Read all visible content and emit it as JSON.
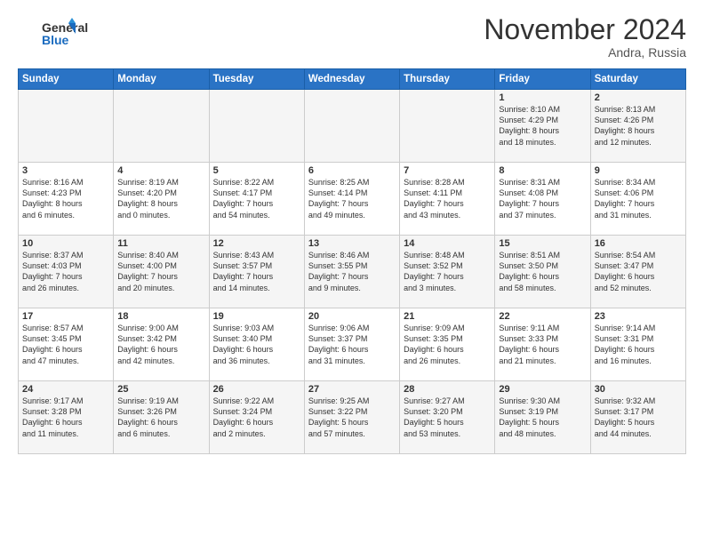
{
  "header": {
    "logo_line1": "General",
    "logo_line2": "Blue",
    "month_title": "November 2024",
    "location": "Andra, Russia"
  },
  "weekdays": [
    "Sunday",
    "Monday",
    "Tuesday",
    "Wednesday",
    "Thursday",
    "Friday",
    "Saturday"
  ],
  "weeks": [
    [
      {
        "day": "",
        "content": ""
      },
      {
        "day": "",
        "content": ""
      },
      {
        "day": "",
        "content": ""
      },
      {
        "day": "",
        "content": ""
      },
      {
        "day": "",
        "content": ""
      },
      {
        "day": "1",
        "content": "Sunrise: 8:10 AM\nSunset: 4:29 PM\nDaylight: 8 hours\nand 18 minutes."
      },
      {
        "day": "2",
        "content": "Sunrise: 8:13 AM\nSunset: 4:26 PM\nDaylight: 8 hours\nand 12 minutes."
      }
    ],
    [
      {
        "day": "3",
        "content": "Sunrise: 8:16 AM\nSunset: 4:23 PM\nDaylight: 8 hours\nand 6 minutes."
      },
      {
        "day": "4",
        "content": "Sunrise: 8:19 AM\nSunset: 4:20 PM\nDaylight: 8 hours\nand 0 minutes."
      },
      {
        "day": "5",
        "content": "Sunrise: 8:22 AM\nSunset: 4:17 PM\nDaylight: 7 hours\nand 54 minutes."
      },
      {
        "day": "6",
        "content": "Sunrise: 8:25 AM\nSunset: 4:14 PM\nDaylight: 7 hours\nand 49 minutes."
      },
      {
        "day": "7",
        "content": "Sunrise: 8:28 AM\nSunset: 4:11 PM\nDaylight: 7 hours\nand 43 minutes."
      },
      {
        "day": "8",
        "content": "Sunrise: 8:31 AM\nSunset: 4:08 PM\nDaylight: 7 hours\nand 37 minutes."
      },
      {
        "day": "9",
        "content": "Sunrise: 8:34 AM\nSunset: 4:06 PM\nDaylight: 7 hours\nand 31 minutes."
      }
    ],
    [
      {
        "day": "10",
        "content": "Sunrise: 8:37 AM\nSunset: 4:03 PM\nDaylight: 7 hours\nand 26 minutes."
      },
      {
        "day": "11",
        "content": "Sunrise: 8:40 AM\nSunset: 4:00 PM\nDaylight: 7 hours\nand 20 minutes."
      },
      {
        "day": "12",
        "content": "Sunrise: 8:43 AM\nSunset: 3:57 PM\nDaylight: 7 hours\nand 14 minutes."
      },
      {
        "day": "13",
        "content": "Sunrise: 8:46 AM\nSunset: 3:55 PM\nDaylight: 7 hours\nand 9 minutes."
      },
      {
        "day": "14",
        "content": "Sunrise: 8:48 AM\nSunset: 3:52 PM\nDaylight: 7 hours\nand 3 minutes."
      },
      {
        "day": "15",
        "content": "Sunrise: 8:51 AM\nSunset: 3:50 PM\nDaylight: 6 hours\nand 58 minutes."
      },
      {
        "day": "16",
        "content": "Sunrise: 8:54 AM\nSunset: 3:47 PM\nDaylight: 6 hours\nand 52 minutes."
      }
    ],
    [
      {
        "day": "17",
        "content": "Sunrise: 8:57 AM\nSunset: 3:45 PM\nDaylight: 6 hours\nand 47 minutes."
      },
      {
        "day": "18",
        "content": "Sunrise: 9:00 AM\nSunset: 3:42 PM\nDaylight: 6 hours\nand 42 minutes."
      },
      {
        "day": "19",
        "content": "Sunrise: 9:03 AM\nSunset: 3:40 PM\nDaylight: 6 hours\nand 36 minutes."
      },
      {
        "day": "20",
        "content": "Sunrise: 9:06 AM\nSunset: 3:37 PM\nDaylight: 6 hours\nand 31 minutes."
      },
      {
        "day": "21",
        "content": "Sunrise: 9:09 AM\nSunset: 3:35 PM\nDaylight: 6 hours\nand 26 minutes."
      },
      {
        "day": "22",
        "content": "Sunrise: 9:11 AM\nSunset: 3:33 PM\nDaylight: 6 hours\nand 21 minutes."
      },
      {
        "day": "23",
        "content": "Sunrise: 9:14 AM\nSunset: 3:31 PM\nDaylight: 6 hours\nand 16 minutes."
      }
    ],
    [
      {
        "day": "24",
        "content": "Sunrise: 9:17 AM\nSunset: 3:28 PM\nDaylight: 6 hours\nand 11 minutes."
      },
      {
        "day": "25",
        "content": "Sunrise: 9:19 AM\nSunset: 3:26 PM\nDaylight: 6 hours\nand 6 minutes."
      },
      {
        "day": "26",
        "content": "Sunrise: 9:22 AM\nSunset: 3:24 PM\nDaylight: 6 hours\nand 2 minutes."
      },
      {
        "day": "27",
        "content": "Sunrise: 9:25 AM\nSunset: 3:22 PM\nDaylight: 5 hours\nand 57 minutes."
      },
      {
        "day": "28",
        "content": "Sunrise: 9:27 AM\nSunset: 3:20 PM\nDaylight: 5 hours\nand 53 minutes."
      },
      {
        "day": "29",
        "content": "Sunrise: 9:30 AM\nSunset: 3:19 PM\nDaylight: 5 hours\nand 48 minutes."
      },
      {
        "day": "30",
        "content": "Sunrise: 9:32 AM\nSunset: 3:17 PM\nDaylight: 5 hours\nand 44 minutes."
      }
    ]
  ]
}
